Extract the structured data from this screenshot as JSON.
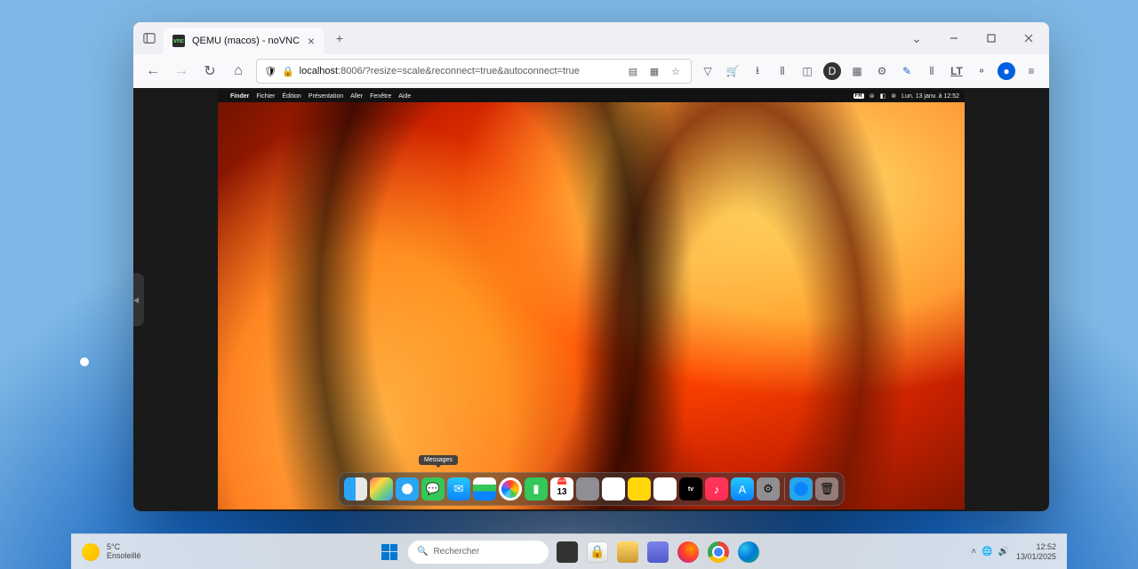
{
  "browser": {
    "tab": {
      "title": "QEMU (macos) - noVNC"
    },
    "url": {
      "prefix": "localhost",
      "path": ":8006/?resize=scale&reconnect=true&autoconnect=true"
    }
  },
  "mac": {
    "menubar": {
      "app": "Finder",
      "items": [
        "Fichier",
        "Édition",
        "Présentation",
        "Aller",
        "Fenêtre",
        "Aide"
      ],
      "lang": "FR",
      "datetime": "Lun. 13 janv. à 12:52"
    },
    "dock": {
      "tooltip": "Messages",
      "calendar": {
        "month": "JANV.",
        "day": "13"
      },
      "tv": "tv"
    }
  },
  "windows": {
    "weather": {
      "temp": "5°C",
      "cond": "Ensoleillé"
    },
    "search": {
      "placeholder": "Rechercher"
    },
    "time": "12:52",
    "date": "13/01/2025"
  }
}
